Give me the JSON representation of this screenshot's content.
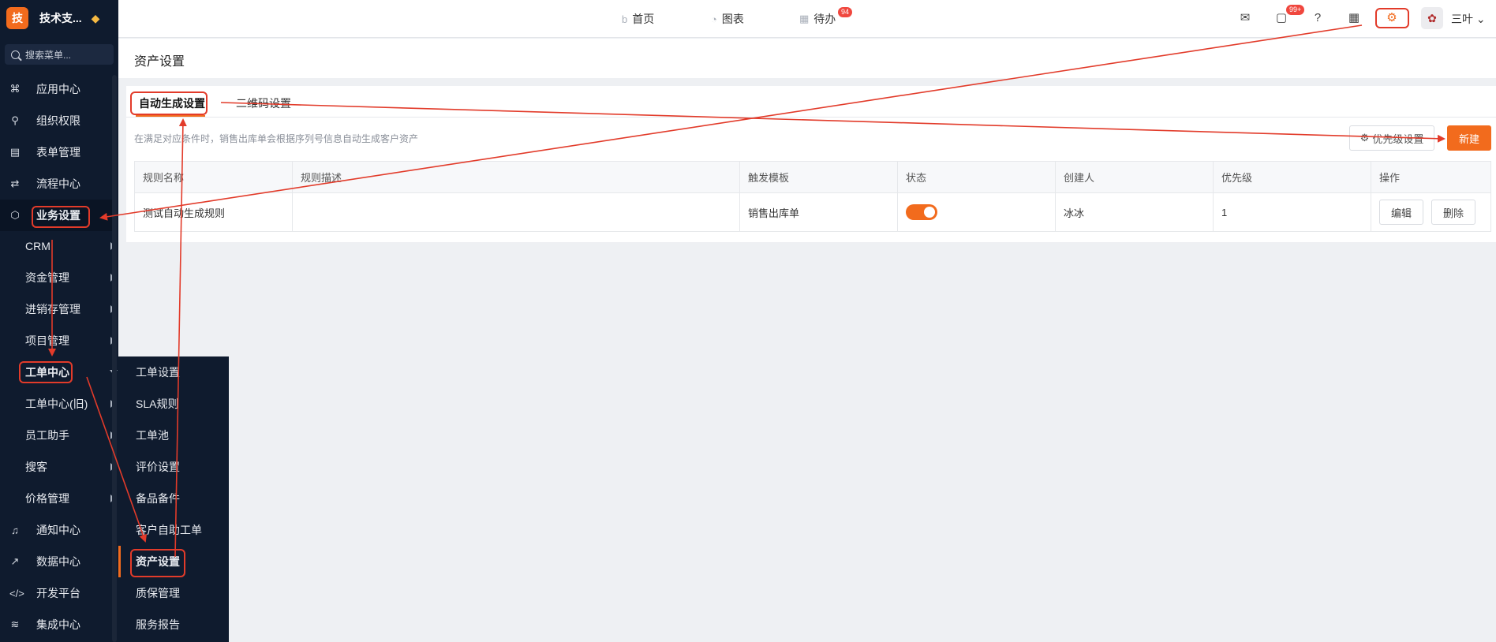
{
  "brand": {
    "logo": "技",
    "name": "技术支...",
    "badge_icon": "diamond-icon"
  },
  "search": {
    "placeholder": "搜索菜单..."
  },
  "sidebar": {
    "items": [
      {
        "label": "应用中心",
        "icon": "apps-icon"
      },
      {
        "label": "组织权限",
        "icon": "user-icon"
      },
      {
        "label": "表单管理",
        "icon": "form-icon"
      },
      {
        "label": "流程中心",
        "icon": "flow-icon"
      },
      {
        "label": "业务设置",
        "icon": "cube-icon"
      },
      {
        "label": "通知中心",
        "icon": "bell-icon"
      },
      {
        "label": "数据中心",
        "icon": "chart-icon"
      },
      {
        "label": "开发平台",
        "icon": "code-icon"
      },
      {
        "label": "集成中心",
        "icon": "layers-icon"
      }
    ],
    "submenu": [
      "CRM",
      "资金管理",
      "进销存管理",
      "项目管理",
      "工单中心",
      "工单中心(旧)",
      "员工助手",
      "搜客",
      "价格管理"
    ]
  },
  "flyout": [
    "工单设置",
    "SLA规则",
    "工单池",
    "评价设置",
    "备品备件",
    "客户自助工单",
    "资产设置",
    "质保管理",
    "服务报告"
  ],
  "topbar": {
    "nav": [
      {
        "label": "首页",
        "icon": "home-b-icon"
      },
      {
        "label": "图表",
        "icon": "pie-icon"
      },
      {
        "label": "待办",
        "icon": "calendar-icon",
        "badge": "94"
      }
    ],
    "msg_badge": "99+",
    "user": "三叶"
  },
  "page": {
    "title": "资产设置"
  },
  "tabs": [
    "自动生成设置",
    "二维码设置"
  ],
  "hint": "在满足对应条件时，销售出库单会根据序列号信息自动生成客户资产",
  "buttons": {
    "priority": "优先级设置",
    "new": "新建"
  },
  "table": {
    "headers": [
      "规则名称",
      "规则描述",
      "触发模板",
      "状态",
      "创建人",
      "优先级",
      "操作"
    ],
    "rows": [
      {
        "name": "测试自动生成规则",
        "desc": "",
        "template": "销售出库单",
        "status": true,
        "creator": "冰冰",
        "priority": "1",
        "actions": [
          "编辑",
          "删除"
        ]
      }
    ]
  },
  "accent": "#f26b1d",
  "annotation_color": "#e23b2a"
}
